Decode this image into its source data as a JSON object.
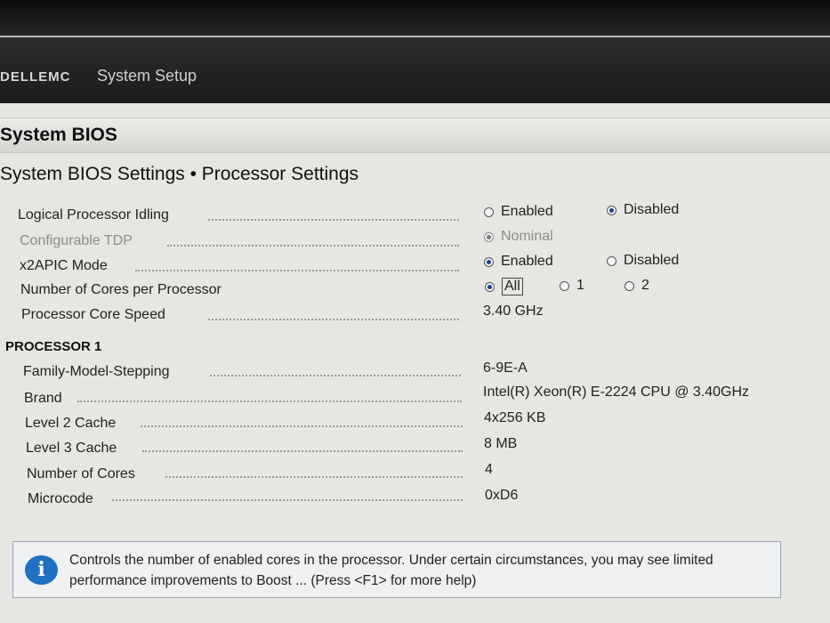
{
  "header": {
    "logo": "DELLEMC",
    "title": "System Setup"
  },
  "page": {
    "title": "System BIOS",
    "breadcrumb": "System BIOS Settings • Processor Settings"
  },
  "settings": [
    {
      "label": "Logical Processor Idling",
      "options": [
        "Enabled",
        "Disabled"
      ],
      "selected": "Disabled"
    },
    {
      "label": "Configurable TDP",
      "options": [
        "Nominal"
      ],
      "selected": "Nominal",
      "disabled": true
    },
    {
      "label": "x2APIC Mode",
      "options": [
        "Enabled",
        "Disabled"
      ],
      "selected": "Enabled"
    },
    {
      "label": "Number of Cores per Processor",
      "options": [
        "All",
        "1",
        "2"
      ],
      "selected": "All"
    },
    {
      "label": "Processor Core Speed",
      "value": "3.40 GHz"
    }
  ],
  "processor": {
    "heading": "PROCESSOR 1",
    "rows": [
      {
        "label": "Family-Model-Stepping",
        "value": "6-9E-A"
      },
      {
        "label": "Brand",
        "value": "Intel(R) Xeon(R) E-2224 CPU @ 3.40GHz"
      },
      {
        "label": "Level 2 Cache",
        "value": "4x256 KB"
      },
      {
        "label": "Level 3 Cache",
        "value": "8 MB"
      },
      {
        "label": "Number of Cores",
        "value": "4"
      },
      {
        "label": "Microcode",
        "value": "0xD6"
      }
    ]
  },
  "help": {
    "icon": "info-icon",
    "text": "Controls the number of enabled cores in the processor. Under certain circumstances, you may see limited performance improvements to Boost ... (Press <F1> for more help)"
  }
}
